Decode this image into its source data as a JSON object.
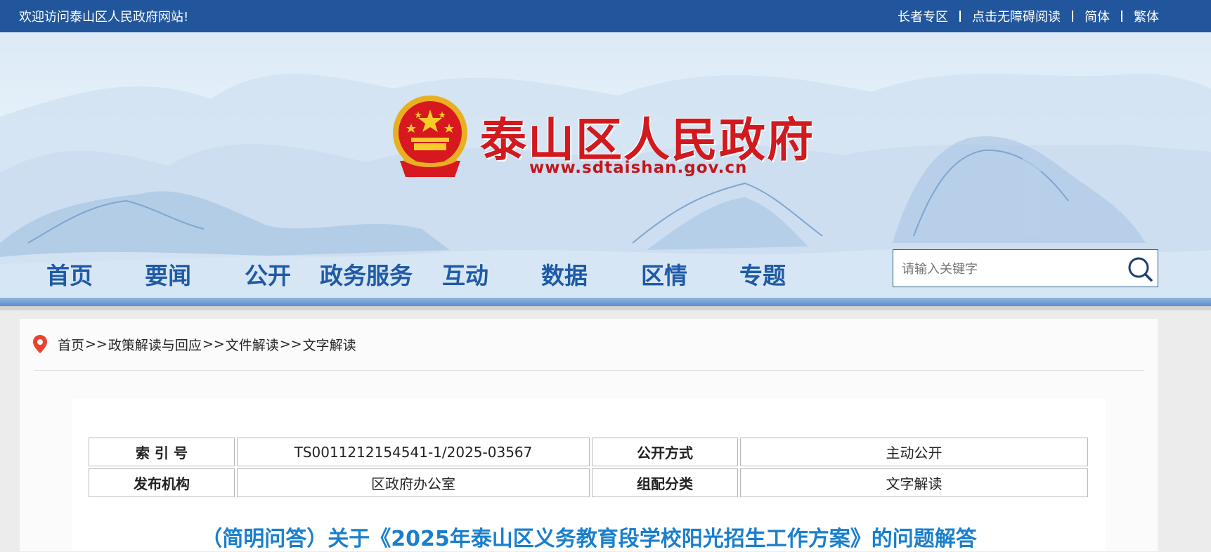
{
  "topbar": {
    "welcome": "欢迎访问泰山区人民政府网站!",
    "links": [
      "长者专区",
      "点击无障碍阅读",
      "简体",
      "繁体"
    ]
  },
  "header": {
    "title": "泰山区人民政府",
    "url": "www.sdtaishan.gov.cn"
  },
  "nav": {
    "items": [
      "首页",
      "要闻",
      "公开",
      "政务服务",
      "互动",
      "数据",
      "区情",
      "专题"
    ]
  },
  "search": {
    "placeholder": "请输入关键字",
    "value": ""
  },
  "breadcrumb": {
    "items": [
      "首页",
      "政策解读与回应",
      "文件解读",
      "文字解读"
    ],
    "separator": ">>"
  },
  "meta": {
    "index_label": "索 引 号",
    "index_value": "TS0011212154541-1/2025-03567",
    "open_label": "公开方式",
    "open_value": "主动公开",
    "org_label": "发布机构",
    "org_value": "区政府办公室",
    "category_label": "组配分类",
    "category_value": "文字解读"
  },
  "article": {
    "title": "（简明问答）关于《2025年泰山区义务教育段学校阳光招生工作方案》的问题解答"
  },
  "colors": {
    "topbar": "#22569c",
    "nav_text": "#1f5aa6",
    "title_red": "#d01a1f",
    "article_title": "#1a7fcd"
  }
}
